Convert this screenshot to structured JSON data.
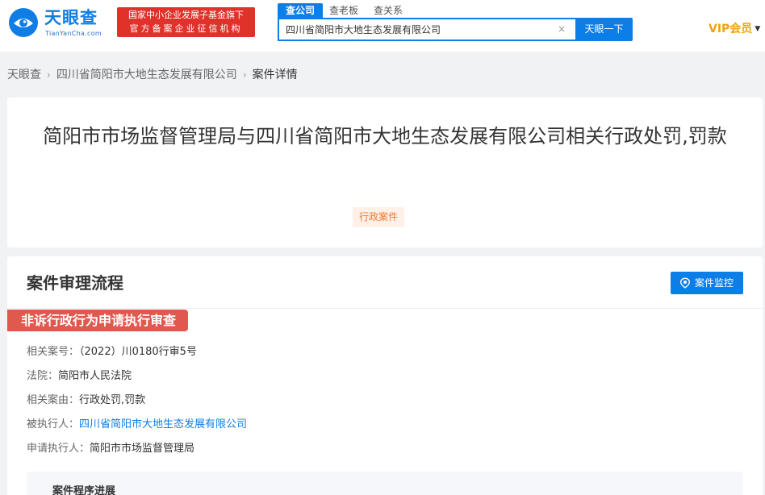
{
  "header": {
    "logo_text": "天眼查",
    "logo_subtext": "TianYanCha.com",
    "fund_badge_line1": "国家中小企业发展子基金旗下",
    "fund_badge_line2": "官方备案企业征信机构",
    "search_tabs": [
      {
        "label": "查公司",
        "active": true
      },
      {
        "label": "查老板",
        "active": false
      },
      {
        "label": "查关系",
        "active": false
      }
    ],
    "search_value": "四川省简阳市大地生态发展有限公司",
    "search_button_label": "天眼一下",
    "clear_glyph": "×",
    "vip_label": "VIP会员",
    "vip_arrow_glyph": "▼"
  },
  "breadcrumb": {
    "items": [
      "天眼查",
      "四川省简阳市大地生态发展有限公司",
      "案件详情"
    ],
    "separator": "›"
  },
  "case": {
    "title": "简阳市市场监督管理局与四川省简阳市大地生态发展有限公司相关行政处罚,罚款",
    "type_tag": "行政案件"
  },
  "process": {
    "title": "案件审理流程",
    "monitor_button_label": "案件监控",
    "stage_title": "非诉行政行为申请执行审查",
    "details": [
      {
        "label": "相关案号：",
        "value": "（2022）川0180行审5号",
        "link": false
      },
      {
        "label": "法院：",
        "value": "简阳市人民法院",
        "link": false
      },
      {
        "label": "相关案由：",
        "value": "行政处罚,罚款",
        "link": false
      },
      {
        "label": "被执行人：",
        "value": "四川省简阳市大地生态发展有限公司",
        "link": true
      },
      {
        "label": "申请执行人：",
        "value": "简阳市市场监督管理局",
        "link": false
      }
    ],
    "progress_label": "案件程序进展"
  },
  "colors": {
    "brand_blue": "#0c7ee7",
    "fund_red": "#e0312b",
    "stage_red": "#e1584e",
    "tag_orange": "#ef7a31",
    "vip_gold": "#f0a30a"
  },
  "icons": {
    "logo": "tianyancha-eye-logo-icon",
    "monitor": "monitor-eye-icon",
    "clear": "clear-icon",
    "vip_arrow": "chevron-down-icon"
  }
}
